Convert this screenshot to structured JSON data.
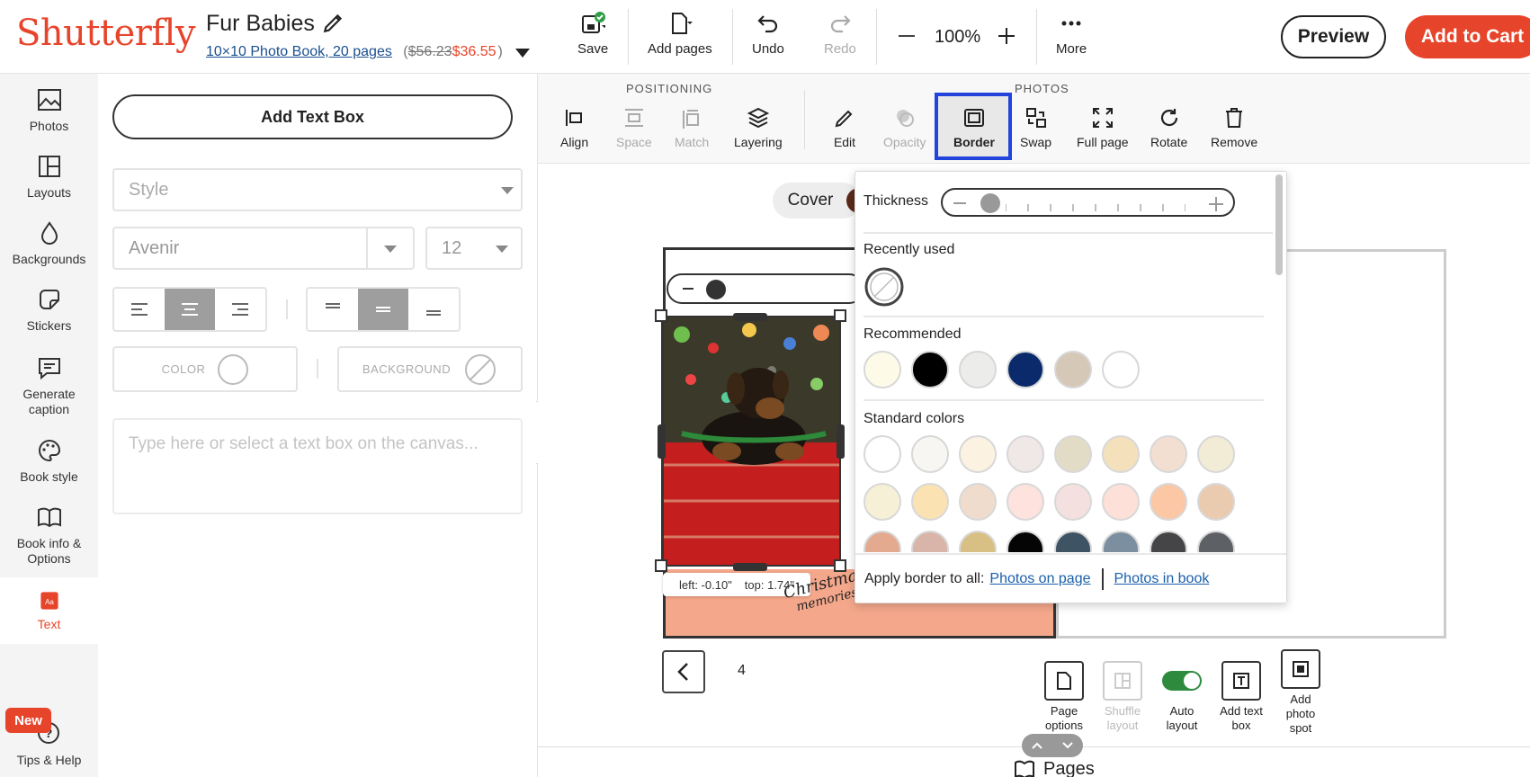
{
  "header": {
    "logo": "Shutterfly",
    "book_title": "Fur Babies",
    "book_type": "10×10 Photo Book, 20 pages",
    "price_open": "(",
    "old_price": "$56.23",
    "new_price": "$36.55",
    "price_close": ")",
    "save": "Save",
    "add_pages": "Add pages",
    "undo": "Undo",
    "redo": "Redo",
    "zoom": "100%",
    "more": "More",
    "preview": "Preview",
    "add_to_cart": "Add to Cart"
  },
  "sidebar": {
    "items": [
      {
        "label": "Photos",
        "icon": "photos-icon"
      },
      {
        "label": "Layouts",
        "icon": "layouts-icon"
      },
      {
        "label": "Backgrounds",
        "icon": "backgrounds-icon"
      },
      {
        "label": "Stickers",
        "icon": "stickers-icon"
      },
      {
        "label": "Generate caption",
        "icon": "caption-icon"
      },
      {
        "label": "Book style",
        "icon": "palette-icon"
      },
      {
        "label": "Book info & Options",
        "icon": "book-icon"
      },
      {
        "label": "Text",
        "icon": "text-icon"
      }
    ],
    "new_badge": "New",
    "help": "Tips & Help",
    "accent": "#e7452b"
  },
  "text_panel": {
    "add_text_box": "Add Text Box",
    "style_placeholder": "Style",
    "font": "Avenir",
    "size": "12",
    "color_label": "COLOR",
    "background_label": "BACKGROUND",
    "text_placeholder": "Type here or select a text box on the canvas..."
  },
  "photo_toolbar": {
    "positioning_label": "POSITIONING",
    "photos_label": "PHOTOS",
    "align": "Align",
    "space": "Space",
    "match": "Match",
    "layering": "Layering",
    "edit": "Edit",
    "opacity": "Opacity",
    "border": "Border",
    "swap": "Swap",
    "full_page": "Full page",
    "rotate": "Rotate",
    "remove": "Remove"
  },
  "canvas": {
    "cover_tab": "Cover",
    "position_tip_left": "left: -0.10\"",
    "position_tip_top": "top: 1.74\"",
    "page_number": "4",
    "script_line1": "Christmas",
    "script_line2": "memories",
    "bottom_tools": {
      "page_options": "Page options",
      "shuffle_layout": "Shuffle layout",
      "auto_layout": "Auto layout",
      "add_text_box": "Add text box",
      "add_photo_spot": "Add photo spot"
    },
    "pages_label": "Pages",
    "page_bottom_color": "#f4a78b"
  },
  "border_popup": {
    "thickness_label": "Thickness",
    "recently_used_label": "Recently used",
    "recommended_label": "Recommended",
    "recommended_colors": [
      "#fdfbe8",
      "#000000",
      "#ececea",
      "#0a2a6b",
      "#d6c8b6",
      "#ffffff"
    ],
    "standard_label": "Standard colors",
    "standard_colors": [
      [
        "#ffffff",
        "#f7f6f2",
        "#fbf2e2",
        "#efe8e6",
        "#e2dcc6",
        "#f4e1bb",
        "#f3dfd2",
        "#f2ecd6"
      ],
      [
        "#f6f0d6",
        "#fbe2b2",
        "#efdccd",
        "#fde2de",
        "#f5e0e0",
        "#fde0d8",
        "#fcc7a4",
        "#eacbb0"
      ],
      [
        "#e4aa90",
        "#d9b4a8",
        "#d8c084",
        "#050505",
        "#3e5364",
        "#7b8fa0",
        "#454548",
        "#5d6064"
      ]
    ],
    "apply_label": "Apply border to all:",
    "photos_on_page": "Photos on page",
    "photos_in_book": "Photos in book"
  }
}
